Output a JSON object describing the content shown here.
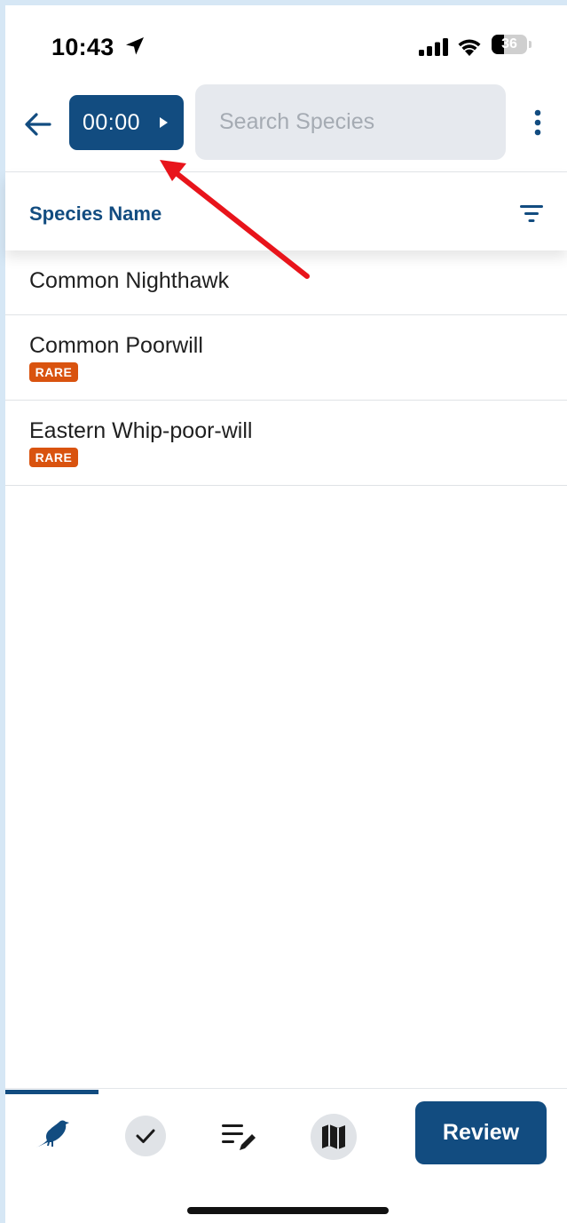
{
  "status_bar": {
    "time": "10:43",
    "battery_level": "36",
    "battery_fraction": 0.36
  },
  "toolbar": {
    "timer": "00:00",
    "search_placeholder": "Search Species"
  },
  "list": {
    "header": "Species Name",
    "items": [
      {
        "name": "Common Nighthawk",
        "badge": ""
      },
      {
        "name": "Common Poorwill",
        "badge": "RARE"
      },
      {
        "name": "Eastern Whip-poor-will",
        "badge": "RARE"
      }
    ]
  },
  "bottom_nav": {
    "review_label": "Review",
    "icons": [
      "bird-icon",
      "check-icon",
      "notes-edit-icon",
      "map-icon"
    ]
  },
  "colors": {
    "primary": "#124c80",
    "rare_badge": "#d9530f",
    "annotation_arrow": "#e8141b"
  }
}
